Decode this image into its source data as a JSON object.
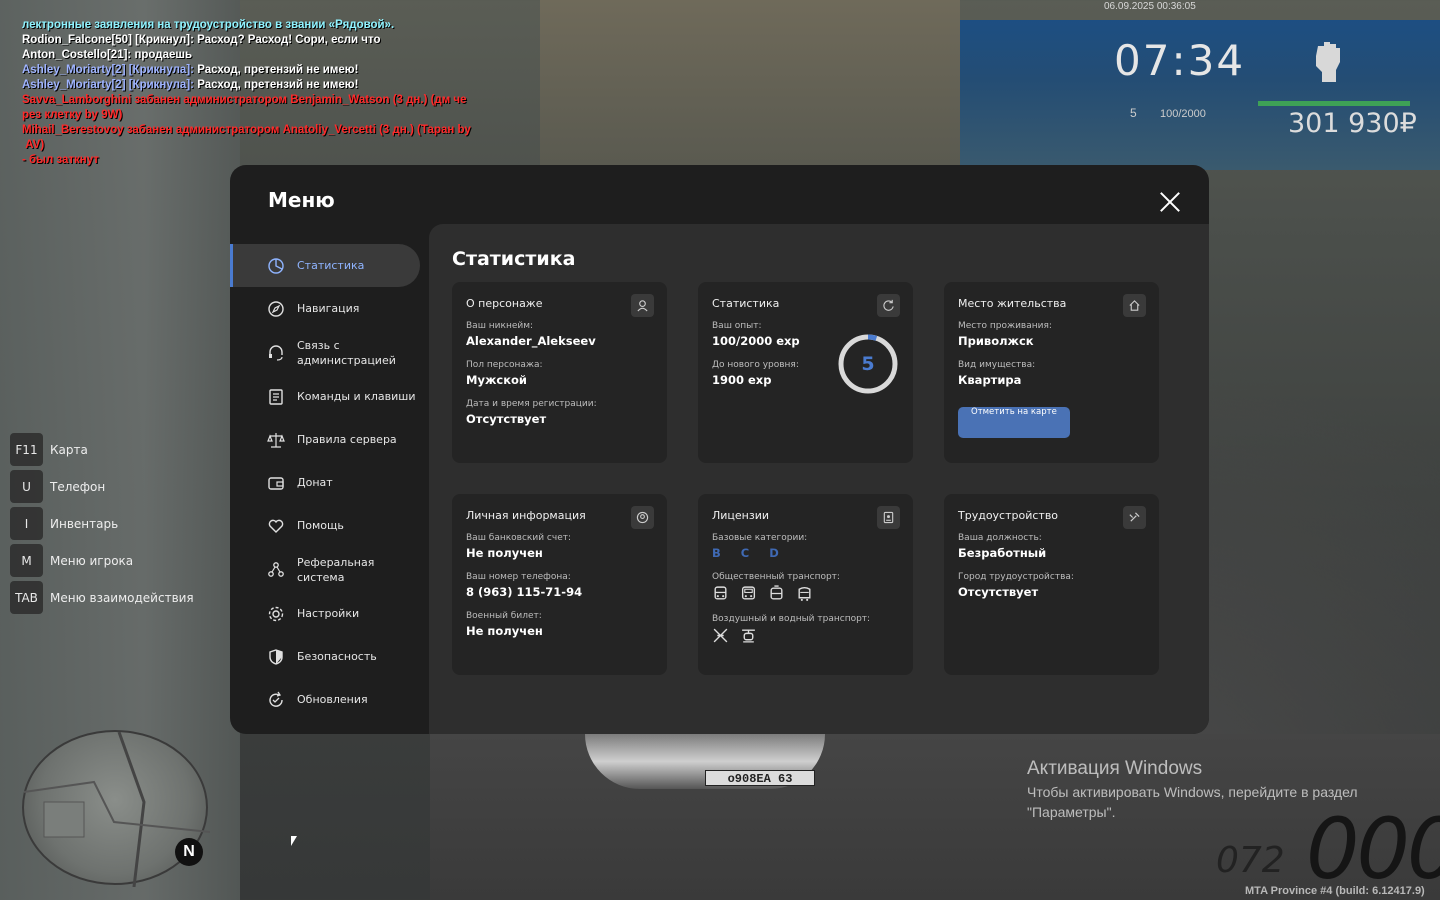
{
  "chat": [
    {
      "parts": [
        {
          "text": "лектронные заявления на трудоустройство в звании «Рядовой».",
          "color": "cyan"
        }
      ]
    },
    {
      "parts": [
        {
          "text": "Rodion_Falcone[50] [Крикнул]: Расход? Расход! Сори, если что",
          "color": "white"
        }
      ]
    },
    {
      "parts": [
        {
          "text": "Anton_Costello[21]: продаешь",
          "color": "white"
        }
      ]
    },
    {
      "parts": [
        {
          "text": "Ashley_Moriarty[2] [Крикнула]: ",
          "color": "blue"
        },
        {
          "text": "Расход, претензий не имею!",
          "color": "white"
        }
      ]
    },
    {
      "parts": [
        {
          "text": "Ashley_Moriarty[2] [Крикнула]: ",
          "color": "blue"
        },
        {
          "text": "Расход, претензий не имею!",
          "color": "white"
        }
      ]
    },
    {
      "parts": [
        {
          "text": "Savva_Lamborghini забанен администратором Benjamin_Watson (3 дн.) (дм че",
          "color": "red"
        }
      ]
    },
    {
      "parts": [
        {
          "text": "рез клетку by 9W)",
          "color": "red"
        }
      ]
    },
    {
      "parts": [
        {
          "text": "Mihail_Berestovoy забанен администратором Anatoliy_Vercetti (3 дн.) (Таран by",
          "color": "red"
        }
      ]
    },
    {
      "parts": [
        {
          "text": " AV)",
          "color": "red"
        }
      ]
    },
    {
      "parts": [
        {
          "text": "- был заткнут",
          "color": "red"
        }
      ]
    }
  ],
  "hud": {
    "datetime": "06.09.2025 00:36:05",
    "time": "07:34",
    "level": "5",
    "exp": "100/2000",
    "money": "301 930₽"
  },
  "keybinds": [
    {
      "key": "F11",
      "label": "Карта"
    },
    {
      "key": "U",
      "label": "Телефон"
    },
    {
      "key": "I",
      "label": "Инвентарь"
    },
    {
      "key": "M",
      "label": "Меню игрока"
    },
    {
      "key": "TAB",
      "label": "Меню взаимодействия"
    }
  ],
  "scene": {
    "plate": "o908EA 63",
    "north": "N"
  },
  "windows": {
    "title": "Активация Windows",
    "text": "Чтобы активировать Windows, перейдите в раздел \"Параметры\"."
  },
  "speedometer": {
    "speed": "000",
    "fuel": "072",
    "build": "MTA Province #4 (build: 6.12417.9)"
  },
  "menu": {
    "title": "Меню",
    "sidebar": [
      {
        "label": "Статистика",
        "icon": "statistics-icon",
        "active": true
      },
      {
        "label": "Навигация",
        "icon": "compass-icon"
      },
      {
        "label": "Связь с администрацией",
        "icon": "headset-icon"
      },
      {
        "label": "Команды и клавиши",
        "icon": "keyboard-icon"
      },
      {
        "label": "Правила сервера",
        "icon": "scales-icon"
      },
      {
        "label": "Донат",
        "icon": "wallet-icon"
      },
      {
        "label": "Помощь",
        "icon": "heart-hands-icon"
      },
      {
        "label": "Реферальная система",
        "icon": "referral-icon"
      },
      {
        "label": "Настройки",
        "icon": "gear-icon"
      },
      {
        "label": "Безопасность",
        "icon": "shield-icon"
      },
      {
        "label": "Обновления",
        "icon": "refresh-icon"
      }
    ],
    "section_title": "Статистика",
    "cards": {
      "character": {
        "title": "О персонаже",
        "nickname_label": "Ваш никнейм:",
        "nickname": "Alexander_Alekseev",
        "gender_label": "Пол персонажа:",
        "gender": "Мужской",
        "reg_label": "Дата и время регистрации:",
        "reg": "Отсутствует"
      },
      "stats": {
        "title": "Статистика",
        "exp_label": "Ваш опыт:",
        "exp": "100/2000 exp",
        "next_label": "До нового уровня:",
        "next": "1900 exp",
        "level": "5",
        "level_progress": 0.05
      },
      "residence": {
        "title": "Место жительства",
        "place_label": "Место проживания:",
        "place": "Приволжск",
        "property_label": "Вид имущества:",
        "property": "Квартира",
        "button": "Отметить на карте"
      },
      "personal": {
        "title": "Личная информация",
        "bank_label": "Ваш банковский счет:",
        "bank": "Не получен",
        "phone_label": "Ваш номер телефона:",
        "phone": "8 (963) 115-71-94",
        "military_label": "Военный билет:",
        "military": "Не получен"
      },
      "licenses": {
        "title": "Лицензии",
        "basic_label": "Базовые категории:",
        "basic": "B C D",
        "public_label": "Общественный транспорт:",
        "public_icons": [
          "bus-icon",
          "bus-front-icon",
          "tram-icon",
          "trolleybus-icon"
        ],
        "air_label": "Воздушный и водный транспорт:",
        "air_icons": [
          "plane-icon",
          "helicopter-icon"
        ]
      },
      "employment": {
        "title": "Трудоустройство",
        "position_label": "Ваша должность:",
        "position": "Безработный",
        "city_label": "Город трудоустройства:",
        "city": "Отсутствует"
      }
    }
  },
  "colors": {
    "accent": "#4a7bd0",
    "button": "#4a72b5",
    "panel": "#1e1e1e",
    "content": "#2e2e2e",
    "card": "#242424"
  }
}
